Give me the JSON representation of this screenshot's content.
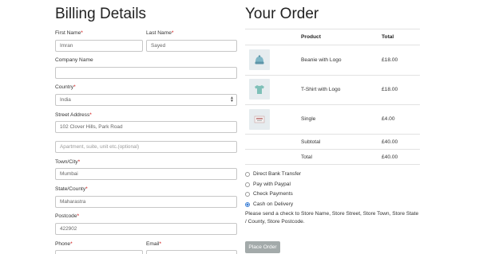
{
  "billing": {
    "title": "Billing Details",
    "required_mark": "*",
    "first_name": {
      "label": "First Name",
      "value": "Imran"
    },
    "last_name": {
      "label": "Last Name",
      "value": "Sayed"
    },
    "company_name": {
      "label": "Company Name",
      "value": ""
    },
    "country": {
      "label": "Country",
      "value": "India"
    },
    "street_address": {
      "label": "Street Address",
      "value": "102 Clover Hills, Park Road",
      "placeholder2": "Apartment, suite, unit etc.(optional)"
    },
    "town_city": {
      "label": "Town/City",
      "value": "Mumbai"
    },
    "state_county": {
      "label": "State/County",
      "value": "Maharastra"
    },
    "postcode": {
      "label": "Postcode",
      "value": "422902"
    },
    "phone": {
      "label": "Phone"
    },
    "email": {
      "label": "Email"
    }
  },
  "order": {
    "title": "Your Order",
    "headers": {
      "product": "Product",
      "total": "Total"
    },
    "items": [
      {
        "name": "Beanie with Logo",
        "total": "£18.00",
        "icon": "beanie-icon"
      },
      {
        "name": "T-Shirt with Logo",
        "total": "£18.00",
        "icon": "tshirt-icon"
      },
      {
        "name": "Single",
        "total": "£4.00",
        "icon": "single-album-icon"
      }
    ],
    "subtotal": {
      "label": "Subtotal",
      "value": "£40.00"
    },
    "total": {
      "label": "Total",
      "value": "£40.00"
    }
  },
  "payment": {
    "options": [
      {
        "label": "Direct Bank Transfer",
        "selected": false
      },
      {
        "label": "Pay with Paypal",
        "selected": false
      },
      {
        "label": "Check Payments",
        "selected": false
      },
      {
        "label": "Cash on Delivery",
        "selected": true
      }
    ],
    "note": "Please send a check to Store Name, Store Street, Store Town, Store State / County, Store Postcode.",
    "place_order_label": "Place Order",
    "accent_color": "#3c7fd6"
  }
}
